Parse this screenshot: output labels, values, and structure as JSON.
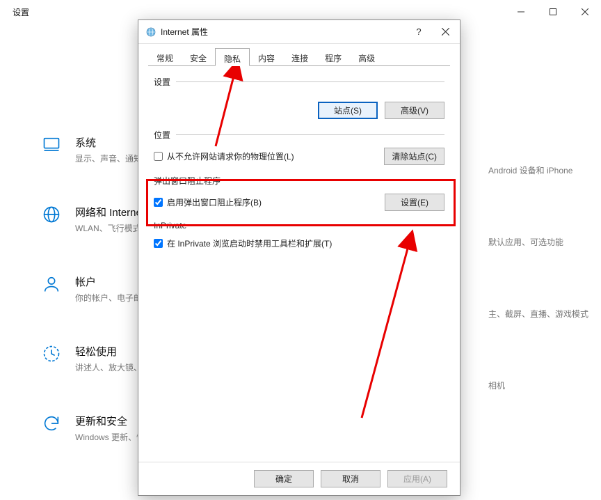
{
  "settings": {
    "title": "设置",
    "nav": [
      {
        "title": "系统",
        "sub": "显示、声音、通知、电源"
      },
      {
        "title": "网络和 Internet",
        "sub": "WLAN、飞行模式、VPN"
      },
      {
        "title": "帐户",
        "sub": "你的帐户、电子邮件、同步设置、工作、家庭"
      },
      {
        "title": "轻松使用",
        "sub": "讲述人、放大镜、高对比度"
      },
      {
        "title": "更新和安全",
        "sub": "Windows 更新、恢复、备份"
      }
    ],
    "right_hints": [
      "Android 设备和 iPhone",
      "默认应用、可选功能",
      "主、截屏、直播、游戏模式",
      "相机"
    ]
  },
  "dialog": {
    "title": "Internet 属性",
    "help_symbol": "?",
    "tabs": [
      "常规",
      "安全",
      "隐私",
      "内容",
      "连接",
      "程序",
      "高级"
    ],
    "active_tab_index": 2,
    "section_settings": {
      "label": "设置",
      "btn_sites": "站点(S)",
      "btn_advanced": "高级(V)"
    },
    "section_location": {
      "label": "位置",
      "checkbox_label": "从不允许网站请求你的物理位置(L)",
      "checkbox_checked": false,
      "btn_clear": "清除站点(C)"
    },
    "section_popup": {
      "label": "弹出窗口阻止程序",
      "checkbox_label": "启用弹出窗口阻止程序(B)",
      "checkbox_checked": true,
      "btn_settings": "设置(E)"
    },
    "section_inprivate": {
      "label": "InPrivate",
      "checkbox_label": "在 InPrivate 浏览启动时禁用工具栏和扩展(T)",
      "checkbox_checked": true
    },
    "footer": {
      "ok": "确定",
      "cancel": "取消",
      "apply": "应用(A)"
    }
  }
}
